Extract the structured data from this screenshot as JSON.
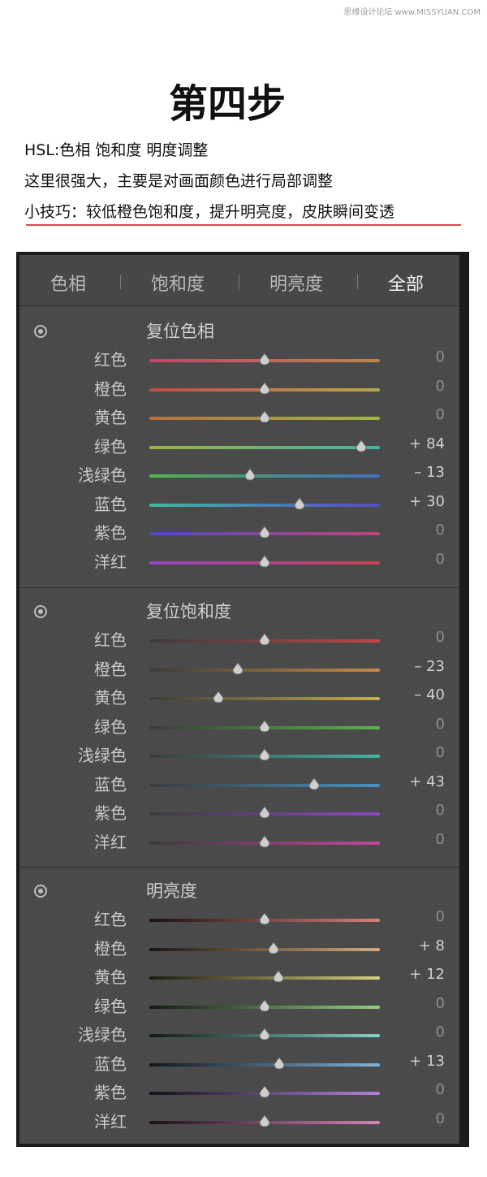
{
  "watermark": "思缘设计论坛 www.MISSYUAN.COM",
  "heading": "第四步",
  "intro": {
    "line1": "HSL:色相   饱和度   明度调整",
    "line2": "这里很强大，主要是对画面颜色进行局部调整",
    "line3": "小技巧：较低橙色饱和度，提升明亮度，皮肤瞬间变透"
  },
  "tabs": [
    {
      "label": "色相"
    },
    {
      "label": "饱和度"
    },
    {
      "label": "明亮度"
    },
    {
      "label": "全部"
    }
  ],
  "sections": [
    {
      "title": "复位色相",
      "rows": [
        {
          "label": "红色",
          "value": "0",
          "v": 0,
          "colors": [
            "#c5436b",
            "#b9874c"
          ]
        },
        {
          "label": "橙色",
          "value": "0",
          "v": 0,
          "colors": [
            "#c64848",
            "#b7a84a"
          ]
        },
        {
          "label": "黄色",
          "value": "0",
          "v": 0,
          "colors": [
            "#b86f3d",
            "#9fb844"
          ]
        },
        {
          "label": "绿色",
          "value": "+ 84",
          "v": 84,
          "colors": [
            "#9ab33f",
            "#3cb6a7"
          ]
        },
        {
          "label": "浅绿色",
          "value": "– 13",
          "v": -13,
          "colors": [
            "#52b34a",
            "#3c6fc4"
          ]
        },
        {
          "label": "蓝色",
          "value": "+ 30",
          "v": 30,
          "colors": [
            "#3db9a1",
            "#5849c4"
          ]
        },
        {
          "label": "紫色",
          "value": "0",
          "v": 0,
          "colors": [
            "#4e47c4",
            "#c1447a"
          ]
        },
        {
          "label": "洋红",
          "value": "0",
          "v": 0,
          "colors": [
            "#9a46c2",
            "#c74455"
          ]
        }
      ]
    },
    {
      "title": "复位饱和度",
      "rows": [
        {
          "label": "红色",
          "value": "0",
          "v": 0,
          "colors": [
            "#3b3b3b",
            "#c24545"
          ]
        },
        {
          "label": "橙色",
          "value": "– 23",
          "v": -23,
          "colors": [
            "#3b3b3b",
            "#c58a45"
          ]
        },
        {
          "label": "黄色",
          "value": "– 40",
          "v": -40,
          "colors": [
            "#3b3b3b",
            "#c4b14a"
          ]
        },
        {
          "label": "绿色",
          "value": "0",
          "v": 0,
          "colors": [
            "#3b3b3b",
            "#57b648"
          ]
        },
        {
          "label": "浅绿色",
          "value": "0",
          "v": 0,
          "colors": [
            "#3b3b3b",
            "#45b5a4"
          ]
        },
        {
          "label": "蓝色",
          "value": "+ 43",
          "v": 43,
          "colors": [
            "#3b3b3b",
            "#4692c2"
          ]
        },
        {
          "label": "紫色",
          "value": "0",
          "v": 0,
          "colors": [
            "#3b3b3b",
            "#8a49c4"
          ]
        },
        {
          "label": "洋红",
          "value": "0",
          "v": 0,
          "colors": [
            "#3b3b3b",
            "#c444a0"
          ]
        }
      ]
    },
    {
      "title": "明亮度",
      "rows": [
        {
          "label": "红色",
          "value": "0",
          "v": 0,
          "colors": [
            "#1a1010",
            "#d8807a"
          ]
        },
        {
          "label": "橙色",
          "value": "+ 8",
          "v": 8,
          "colors": [
            "#1a1510",
            "#d8ab7a"
          ]
        },
        {
          "label": "黄色",
          "value": "+ 12",
          "v": 12,
          "colors": [
            "#1a1a10",
            "#d7d27c"
          ]
        },
        {
          "label": "绿色",
          "value": "0",
          "v": 0,
          "colors": [
            "#101a10",
            "#8fd07d"
          ]
        },
        {
          "label": "浅绿色",
          "value": "0",
          "v": 0,
          "colors": [
            "#101a18",
            "#7ed6c6"
          ]
        },
        {
          "label": "蓝色",
          "value": "+ 13",
          "v": 13,
          "colors": [
            "#10151a",
            "#7fb2db"
          ]
        },
        {
          "label": "紫色",
          "value": "0",
          "v": 0,
          "colors": [
            "#14101a",
            "#b183d8"
          ]
        },
        {
          "label": "洋红",
          "value": "0",
          "v": 0,
          "colors": [
            "#1a1016",
            "#d882b8"
          ]
        }
      ]
    }
  ]
}
